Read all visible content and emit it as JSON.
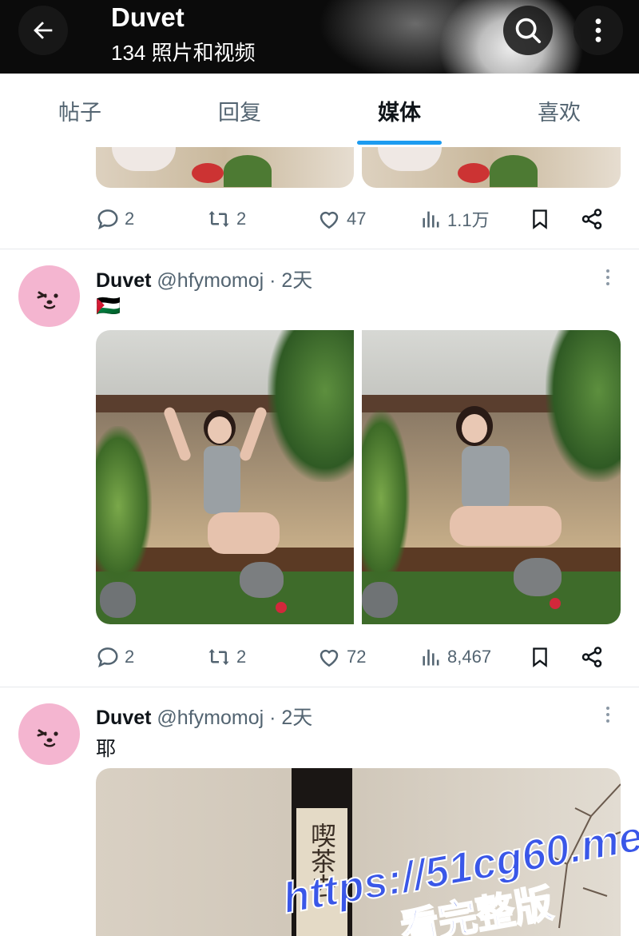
{
  "header": {
    "title": "Duvet",
    "subtitle": "134 照片和视频"
  },
  "tabs": [
    {
      "label": "帖子"
    },
    {
      "label": "回复"
    },
    {
      "label": "媒体"
    },
    {
      "label": "喜欢"
    }
  ],
  "active_tab": "媒体",
  "posts": [
    {
      "actions": {
        "replies": "2",
        "reposts": "2",
        "likes": "47",
        "views": "1.1万"
      }
    },
    {
      "name": "Duvet",
      "handle": "@hfymomoj · 2天",
      "text": "🇵🇸",
      "actions": {
        "replies": "2",
        "reposts": "2",
        "likes": "72",
        "views": "8,467"
      }
    },
    {
      "name": "Duvet",
      "handle": "@hfymomoj · 2天",
      "text": "耶",
      "scroll_calligraphy": "喫茶去"
    }
  ],
  "watermark": {
    "line1": "https://51cg60.me",
    "line2": "看完整版"
  },
  "colors": {
    "accent": "#1d9bf0",
    "avatar_bg": "#f4b5d0",
    "muted": "#536471"
  }
}
